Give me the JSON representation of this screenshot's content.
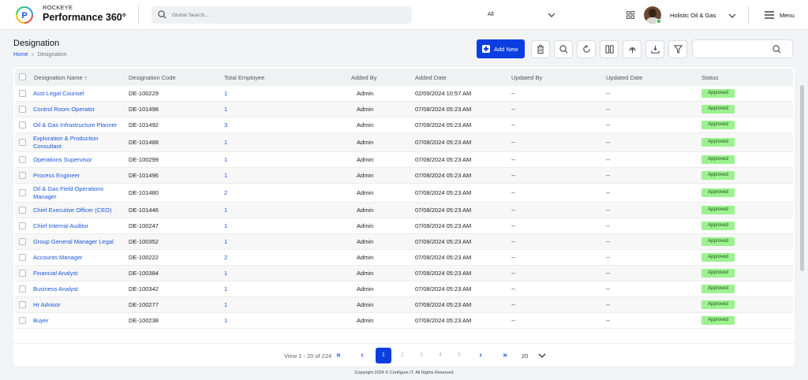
{
  "brand": {
    "company": "ROCKEYE",
    "product": "Performance 360°"
  },
  "search": {
    "placeholder": "Global Search...",
    "scope": "All"
  },
  "user": {
    "org": "Holistic Oil & Gas",
    "menu_label": "Menu"
  },
  "page": {
    "title": "Designation",
    "breadcrumb": {
      "home": "Home",
      "separator": "»",
      "current": "Designation"
    },
    "add_button": "Add New"
  },
  "table": {
    "columns": {
      "name": "Designation Name",
      "code": "Designation Code",
      "total": "Total Employee",
      "added_by": "Added By",
      "added_date": "Added Date",
      "updated_by": "Updated By",
      "updated_date": "Updated Date",
      "status": "Status"
    },
    "sort_indicator": "↑",
    "rows": [
      {
        "name": "Asst Legal Counsel",
        "code": "DE-100229",
        "total": "1",
        "added_by": "Admin",
        "added_date": "02/09/2024 10:57 AM",
        "updated_by": "--",
        "updated_date": "--",
        "status": "Approved"
      },
      {
        "name": "Control Room Operator",
        "code": "DE-101498",
        "total": "1",
        "added_by": "Admin",
        "added_date": "07/08/2024 05:23 AM",
        "updated_by": "--",
        "updated_date": "--",
        "status": "Approved"
      },
      {
        "name": "Oil & Gas Infrastructure Planner",
        "code": "DE-101492",
        "total": "3",
        "added_by": "Admin",
        "added_date": "07/08/2024 05:23 AM",
        "updated_by": "--",
        "updated_date": "--",
        "status": "Approved"
      },
      {
        "name": "Exploration & Production Consultant",
        "code": "DE-101488",
        "total": "1",
        "added_by": "Admin",
        "added_date": "07/08/2024 05:23 AM",
        "updated_by": "--",
        "updated_date": "--",
        "status": "Approved"
      },
      {
        "name": "Operations Supervisor",
        "code": "DE-100299",
        "total": "1",
        "added_by": "Admin",
        "added_date": "07/08/2024 05:23 AM",
        "updated_by": "--",
        "updated_date": "--",
        "status": "Approved"
      },
      {
        "name": "Process Engineer",
        "code": "DE-101496",
        "total": "1",
        "added_by": "Admin",
        "added_date": "07/08/2024 05:23 AM",
        "updated_by": "--",
        "updated_date": "--",
        "status": "Approved"
      },
      {
        "name": "Oil & Gas Field Operations Manager",
        "code": "DE-101480",
        "total": "2",
        "added_by": "Admin",
        "added_date": "07/08/2024 05:23 AM",
        "updated_by": "--",
        "updated_date": "--",
        "status": "Approved"
      },
      {
        "name": "Chief Executive Officer (CEO)",
        "code": "DE-101446",
        "total": "1",
        "added_by": "Admin",
        "added_date": "07/08/2024 05:23 AM",
        "updated_by": "--",
        "updated_date": "--",
        "status": "Approved"
      },
      {
        "name": "Chief Internal Auditor",
        "code": "DE-100247",
        "total": "1",
        "added_by": "Admin",
        "added_date": "07/08/2024 05:23 AM",
        "updated_by": "--",
        "updated_date": "--",
        "status": "Approved"
      },
      {
        "name": "Group General Manager Legal",
        "code": "DE-100352",
        "total": "1",
        "added_by": "Admin",
        "added_date": "07/08/2024 05:23 AM",
        "updated_by": "--",
        "updated_date": "--",
        "status": "Approved"
      },
      {
        "name": "Accounts Manager",
        "code": "DE-100222",
        "total": "2",
        "added_by": "Admin",
        "added_date": "07/08/2024 05:23 AM",
        "updated_by": "--",
        "updated_date": "--",
        "status": "Approved"
      },
      {
        "name": "Financial Analyst",
        "code": "DE-100384",
        "total": "1",
        "added_by": "Admin",
        "added_date": "07/08/2024 05:23 AM",
        "updated_by": "--",
        "updated_date": "--",
        "status": "Approved"
      },
      {
        "name": "Business Analyst",
        "code": "DE-100342",
        "total": "1",
        "added_by": "Admin",
        "added_date": "07/08/2024 05:23 AM",
        "updated_by": "--",
        "updated_date": "--",
        "status": "Approved"
      },
      {
        "name": "Hr Advisor",
        "code": "DE-100277",
        "total": "1",
        "added_by": "Admin",
        "added_date": "07/08/2024 05:23 AM",
        "updated_by": "--",
        "updated_date": "--",
        "status": "Approved"
      },
      {
        "name": "Buyer",
        "code": "DE-100238",
        "total": "1",
        "added_by": "Admin",
        "added_date": "07/08/2024 05:23 AM",
        "updated_by": "--",
        "updated_date": "--",
        "status": "Approved"
      }
    ]
  },
  "pagination": {
    "view_text": "View 1 - 20 of 224",
    "first": "«",
    "prev": "‹",
    "pages": [
      "1",
      "2",
      "3",
      "4",
      "5"
    ],
    "current_page": "1",
    "next": "›",
    "last": "»",
    "per_page": "20"
  },
  "footer": {
    "copyright": "Copyright 2024 © Configure.IT. All Rights Reserved"
  },
  "colors": {
    "accent": "#0b3ee0",
    "link": "#1a56db",
    "status_approved": "#9cf28f"
  },
  "icons": {
    "logo": "rockeye-logo-icon",
    "search": "search-icon",
    "apps": "apps-grid-icon",
    "menu": "hamburger-icon",
    "toolbar": [
      "trash-icon",
      "search-icon",
      "refresh-icon",
      "columns-icon",
      "upload-icon",
      "download-icon",
      "filter-icon"
    ]
  }
}
